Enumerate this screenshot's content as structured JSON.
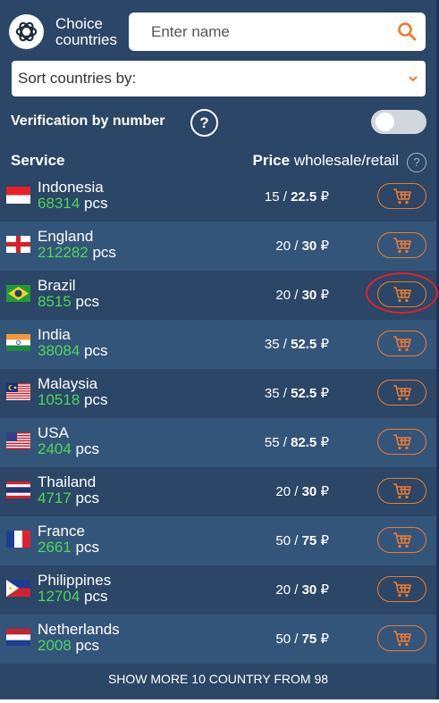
{
  "header": {
    "brand_line1": "Choice",
    "brand_line2": "countries",
    "search_placeholder": "Enter name"
  },
  "sort": {
    "label": "Sort countries by:"
  },
  "verification": {
    "label": "Verification by number",
    "help": "?",
    "enabled": false
  },
  "table": {
    "service_header": "Service",
    "price_header_bold": "Price",
    "price_header_rest": " wholesale/retail",
    "help": "?"
  },
  "rows": [
    {
      "name": "Indonesia",
      "count": "68314",
      "unit": " pcs",
      "wholesale": "15",
      "retail": "22.5",
      "currency": "₽",
      "flag": "indonesia"
    },
    {
      "name": "England",
      "count": "212282",
      "unit": " pcs",
      "wholesale": "20",
      "retail": "30",
      "currency": "₽",
      "flag": "england"
    },
    {
      "name": "Brazil",
      "count": "8515",
      "unit": " pcs",
      "wholesale": "20",
      "retail": "30",
      "currency": "₽",
      "flag": "brazil"
    },
    {
      "name": "India",
      "count": "38084",
      "unit": " pcs",
      "wholesale": "35",
      "retail": "52.5",
      "currency": "₽",
      "flag": "india"
    },
    {
      "name": "Malaysia",
      "count": "10518",
      "unit": " pcs",
      "wholesale": "35",
      "retail": "52.5",
      "currency": "₽",
      "flag": "malaysia"
    },
    {
      "name": "USA",
      "count": "2404",
      "unit": " pcs",
      "wholesale": "55",
      "retail": "82.5",
      "currency": "₽",
      "flag": "usa"
    },
    {
      "name": "Thailand",
      "count": "4717",
      "unit": " pcs",
      "wholesale": "20",
      "retail": "30",
      "currency": "₽",
      "flag": "thailand"
    },
    {
      "name": "France",
      "count": "2661",
      "unit": " pcs",
      "wholesale": "50",
      "retail": "75",
      "currency": "₽",
      "flag": "france"
    },
    {
      "name": "Philippines",
      "count": "12704",
      "unit": " pcs",
      "wholesale": "20",
      "retail": "30",
      "currency": "₽",
      "flag": "philippines"
    },
    {
      "name": "Netherlands",
      "count": "2008",
      "unit": " pcs",
      "wholesale": "50",
      "retail": "75",
      "currency": "₽",
      "flag": "netherlands"
    }
  ],
  "show_more": "SHOW MORE 10 COUNTRY FROM 98",
  "colors": {
    "panel": "#2b4666",
    "row_alt": "#34557a",
    "accent": "#ef7a2e",
    "count_green": "#4fd65a",
    "annotation": "#e0212f"
  },
  "icons": [
    "openai-logo-icon",
    "search-icon",
    "chevron-down-icon",
    "cart-icon",
    "help-icon"
  ]
}
